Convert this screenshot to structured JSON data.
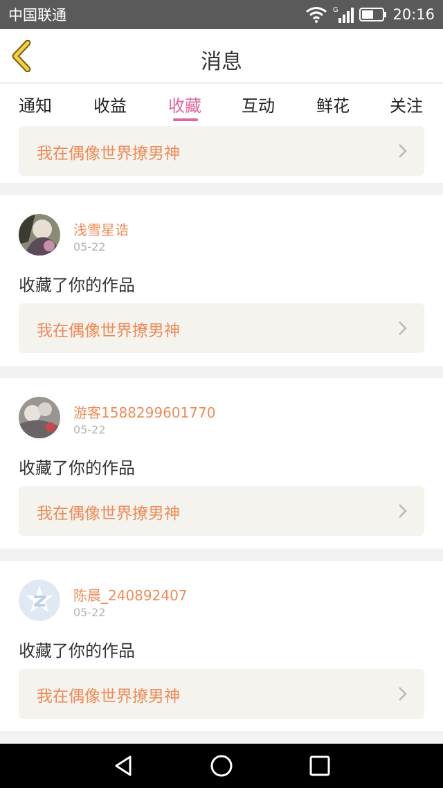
{
  "status_bar": {
    "carrier": "中国联通",
    "network": "G",
    "time": "20:16",
    "icons": [
      "wifi-icon",
      "signal-icon",
      "battery-icon"
    ]
  },
  "header": {
    "title": "消息",
    "back_icon": "chevron-left-icon"
  },
  "tabs": [
    {
      "label": "通知",
      "active": false
    },
    {
      "label": "收益",
      "active": false
    },
    {
      "label": "收藏",
      "active": true
    },
    {
      "label": "互动",
      "active": false
    },
    {
      "label": "鲜花",
      "active": false
    },
    {
      "label": "关注",
      "active": false
    }
  ],
  "partial_item": {
    "work_title": "我在偶像世界撩男神"
  },
  "items": [
    {
      "user": "浅雪星诰",
      "date": "05-22",
      "message": "收藏了你的作品",
      "work_title": "我在偶像世界撩男神",
      "avatar": "photo-avatar"
    },
    {
      "user": "游客1588299601770",
      "date": "05-22",
      "message": "收藏了你的作品",
      "work_title": "我在偶像世界撩男神",
      "avatar": "photo-avatar"
    },
    {
      "user": "陈晨_240892407",
      "date": "05-22",
      "message": "收藏了你的作品",
      "work_title": "我在偶像世界撩男神",
      "avatar": "qq-default-avatar"
    }
  ],
  "colors": {
    "accent": "#e3659c",
    "username": "#ef8a56",
    "work_box_bg": "#f4f3ee"
  },
  "navbar": [
    "back-triangle-icon",
    "home-circle-icon",
    "recents-square-icon"
  ]
}
